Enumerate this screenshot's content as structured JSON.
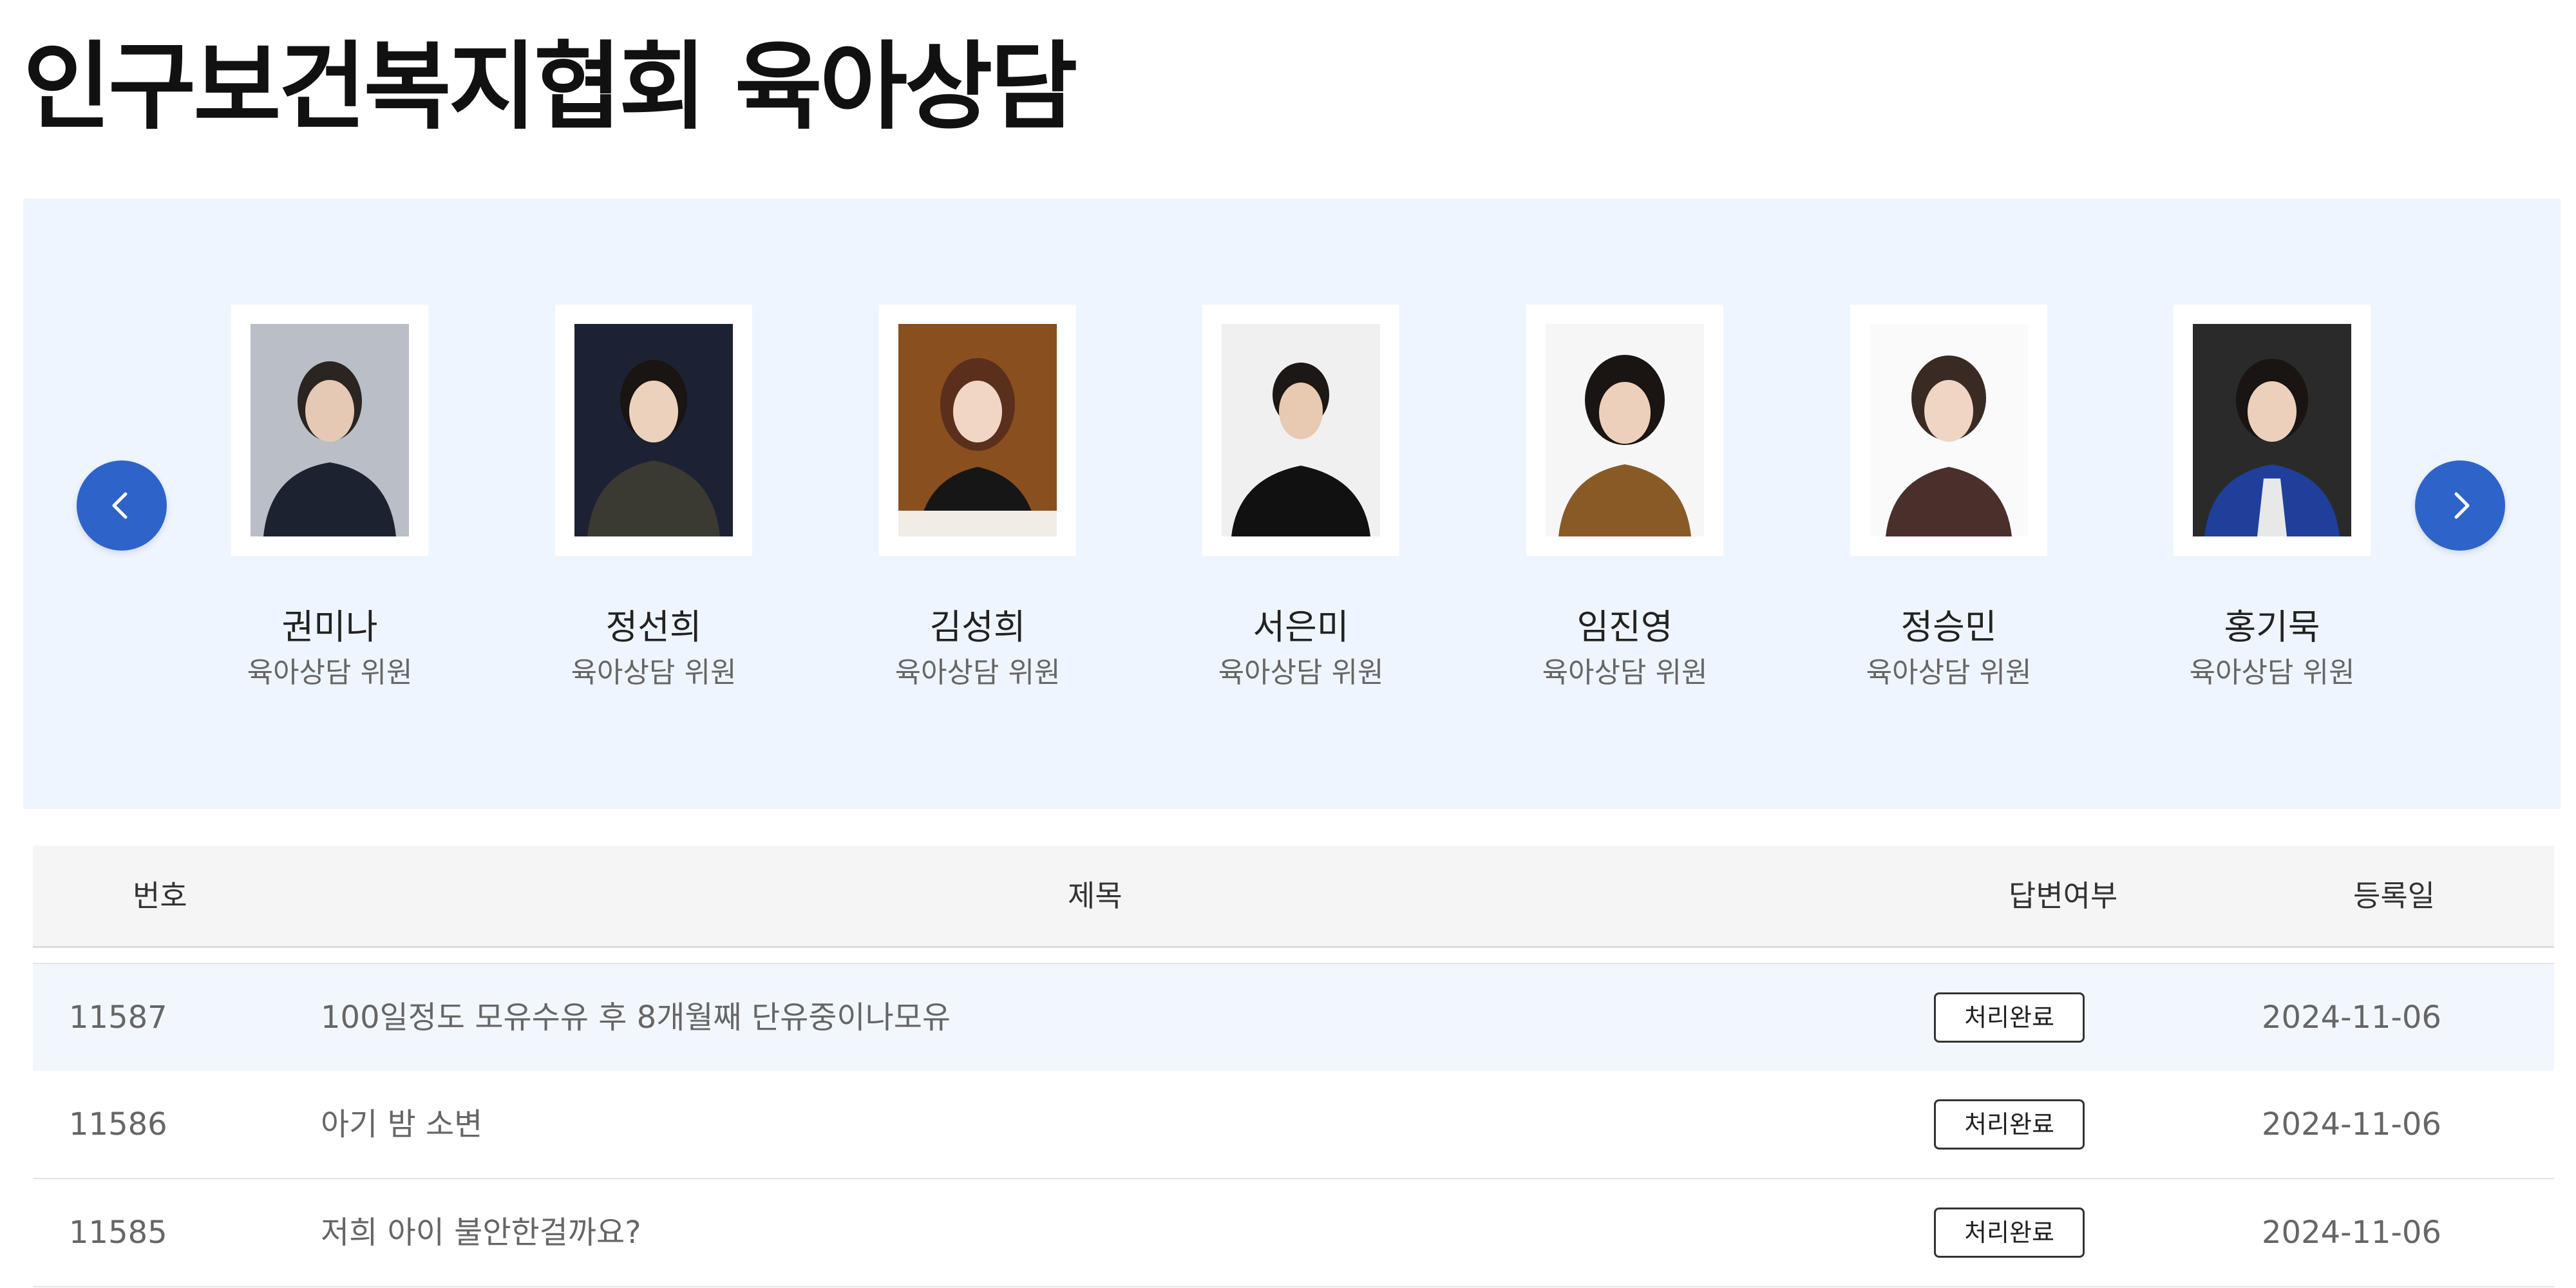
{
  "title": "인구보건복지협회 육아상담",
  "carousel": {
    "prev_icon": "chevron-left-icon",
    "next_icon": "chevron-right-icon",
    "accent_color": "#2e63c9",
    "background_color": "#eef5fe",
    "counselors": [
      {
        "name": "권미나",
        "role": "육아상담 위원"
      },
      {
        "name": "정선희",
        "role": "육아상담 위원"
      },
      {
        "name": "김성희",
        "role": "육아상담 위원"
      },
      {
        "name": "서은미",
        "role": "육아상담 위원"
      },
      {
        "name": "임진영",
        "role": "육아상담 위원"
      },
      {
        "name": "정승민",
        "role": "육아상담 위원"
      },
      {
        "name": "홍기묵",
        "role": "육아상담 위원"
      }
    ]
  },
  "table": {
    "headers": {
      "number": "번호",
      "subject": "제목",
      "answered": "답변여부",
      "date": "등록일"
    },
    "rows": [
      {
        "number": "11587",
        "subject": "100일정도 모유수유 후 8개월째 단유중이나모유",
        "status": "처리완료",
        "date": "2024-11-06"
      },
      {
        "number": "11586",
        "subject": "아기 밤 소변",
        "status": "처리완료",
        "date": "2024-11-06"
      },
      {
        "number": "11585",
        "subject": "저희 아이 불안한걸까요?",
        "status": "처리완료",
        "date": "2024-11-06"
      }
    ]
  }
}
